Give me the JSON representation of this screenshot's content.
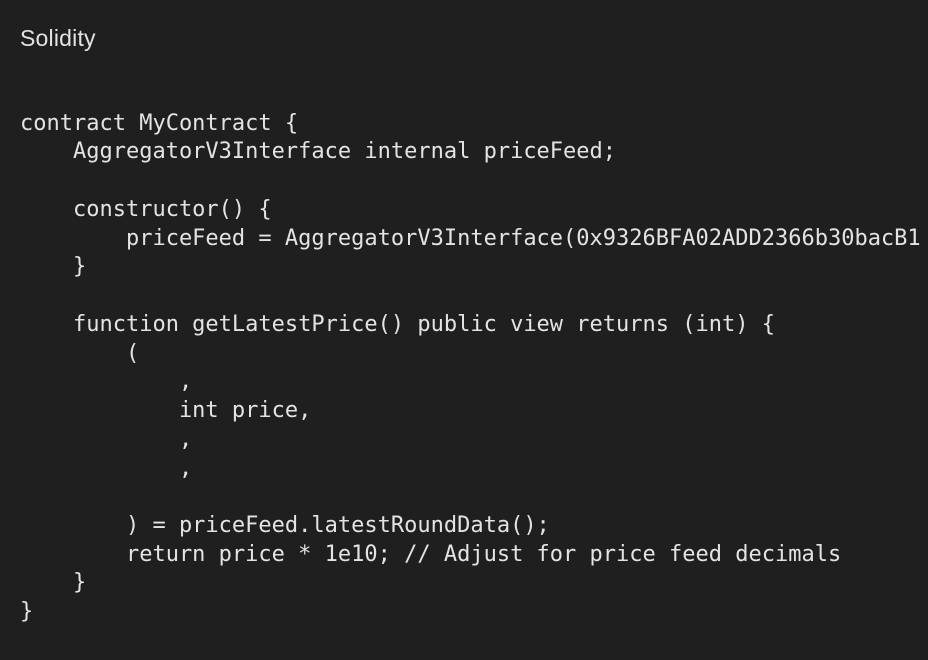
{
  "language_label": "Solidity",
  "code_lines": [
    "contract MyContract {",
    "    AggregatorV3Interface internal priceFeed;",
    "    constructor() {",
    "        priceFeed = AggregatorV3Interface(0x9326BFA02ADD2366b30bacB1",
    "    }",
    "    function getLatestPrice() public view returns (int) {",
    "        (",
    "            ,",
    "            int price,",
    "            ,",
    "            ,",
    "        ) = priceFeed.latestRoundData();",
    "        return price * 1e10; // Adjust for price feed decimals",
    "    }",
    "}"
  ]
}
